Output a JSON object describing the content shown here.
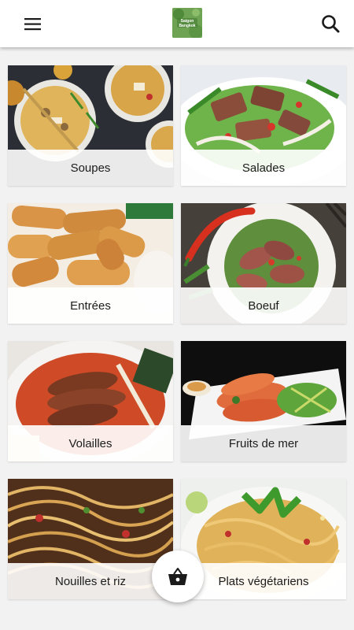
{
  "header": {
    "logo_text": "Saigon Bangkok",
    "menu_icon": "hamburger-menu-icon",
    "search_icon": "search-icon"
  },
  "categories": [
    {
      "label": "Soupes"
    },
    {
      "label": "Salades"
    },
    {
      "label": "Entrées"
    },
    {
      "label": "Boeuf"
    },
    {
      "label": "Volailles"
    },
    {
      "label": "Fruits de mer"
    },
    {
      "label": "Nouilles et riz"
    },
    {
      "label": "Plats végétariens"
    }
  ],
  "cart": {
    "icon": "basket-icon"
  },
  "colors": {
    "appbar": "#ffffff",
    "background": "#f2f2f2",
    "logo": "#6fa354"
  }
}
